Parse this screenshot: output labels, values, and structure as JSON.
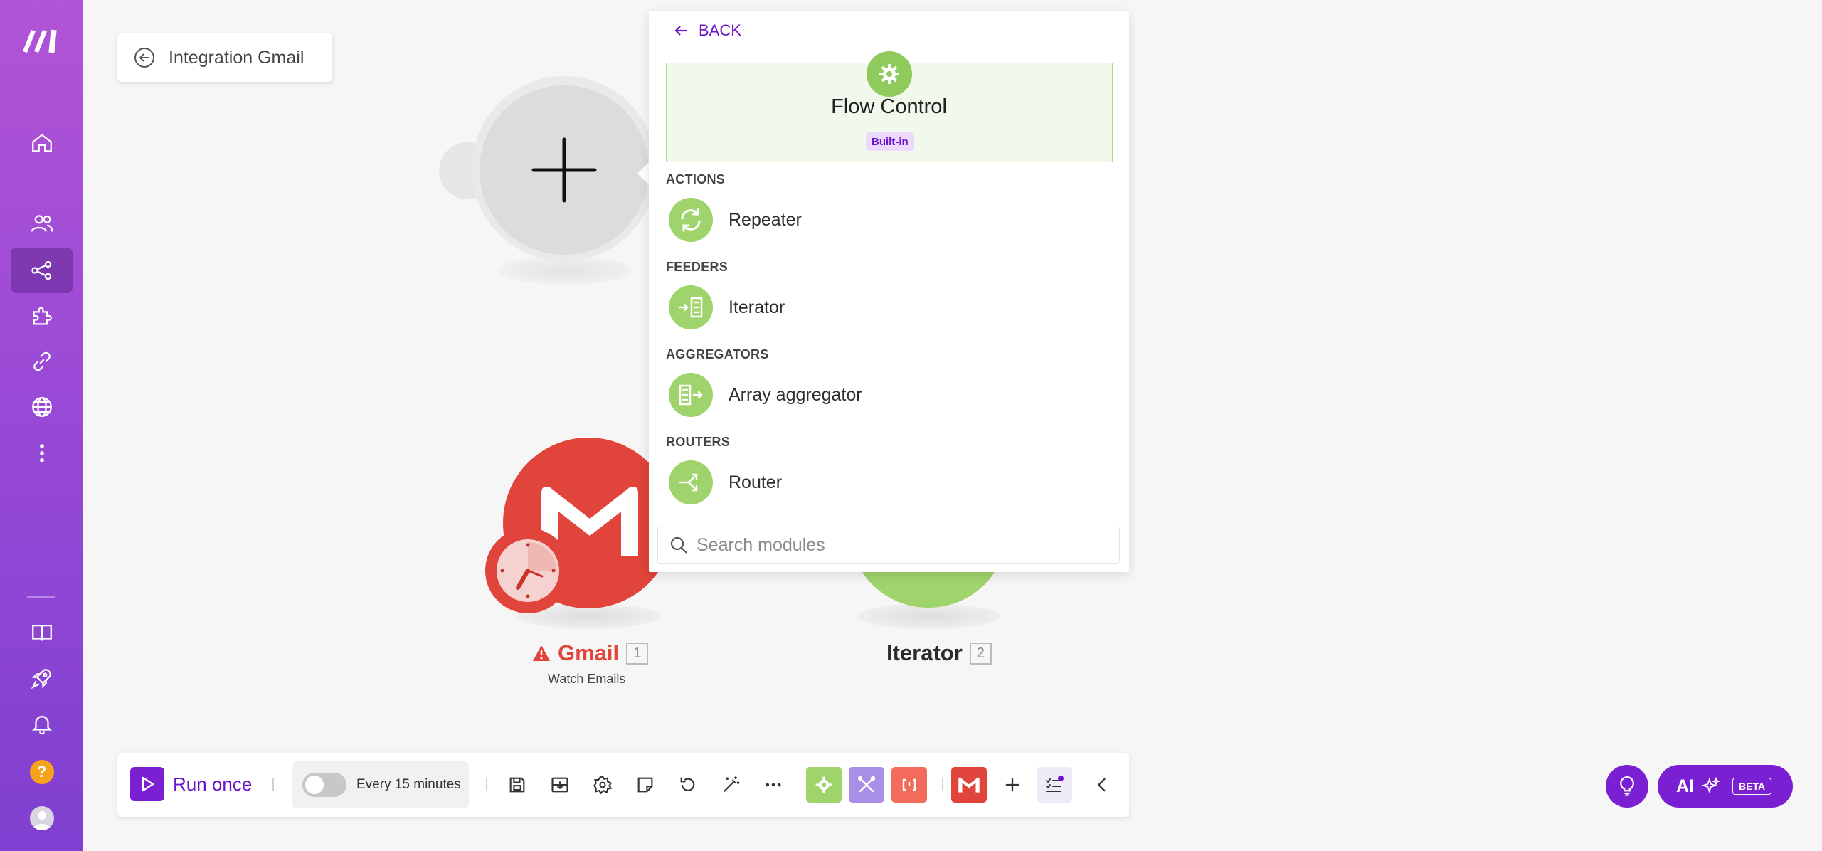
{
  "scenario": {
    "title": "Integration Gmail"
  },
  "picker": {
    "back_label": "BACK",
    "app_title": "Flow Control",
    "app_badge": "Built-in",
    "sections": [
      {
        "heading": "ACTIONS",
        "items": [
          {
            "label": "Repeater",
            "icon": "repeater-icon"
          }
        ]
      },
      {
        "heading": "FEEDERS",
        "items": [
          {
            "label": "Iterator",
            "icon": "iterator-icon"
          }
        ]
      },
      {
        "heading": "AGGREGATORS",
        "items": [
          {
            "label": "Array aggregator",
            "icon": "array-aggregator-icon"
          }
        ]
      },
      {
        "heading": "ROUTERS",
        "items": [
          {
            "label": "Router",
            "icon": "router-icon"
          }
        ]
      }
    ],
    "search_placeholder": "Search modules"
  },
  "nodes": {
    "gmail": {
      "name": "Gmail",
      "number": "1",
      "subtitle": "Watch Emails",
      "color": "#e0443a"
    },
    "iterator": {
      "name": "Iterator",
      "number": "2",
      "color": "#9fd36b"
    }
  },
  "toolbar": {
    "run_once_label": "Run once",
    "schedule_label": "Every 15 minutes",
    "schedule_enabled": false
  },
  "ai": {
    "label": "AI",
    "badge": "BETA"
  },
  "colors": {
    "accent": "#7a1fd1",
    "flow_control_green": "#9fd36b",
    "gmail_red": "#e0443a",
    "warning_red": "#e0443a"
  }
}
